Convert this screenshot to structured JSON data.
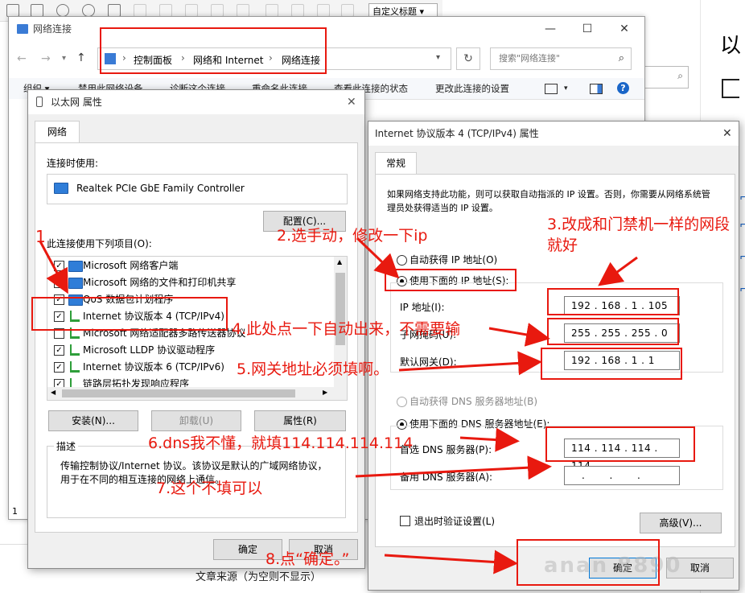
{
  "explorer": {
    "title": "网络连接",
    "breadcrumb": [
      "控制面板",
      "网络和 Internet",
      "网络连接"
    ],
    "search_placeholder": "搜索\"网络连接\"",
    "commands": [
      "组织 ▾",
      "禁用此网络设备",
      "诊断这个连接",
      "重命名此连接",
      "查看此连接的状态",
      "更改此连接的设置"
    ],
    "status_left": "1"
  },
  "eth_dialog": {
    "title": "以太网 属性",
    "tab": "网络",
    "connect_using_label": "连接时使用:",
    "adapter_name": "Realtek PCIe GbE Family Controller",
    "configure_button": "配置(C)...",
    "items_label": "此连接使用下列项目(O):",
    "items": [
      {
        "label": "Microsoft 网络客户端",
        "checked": true
      },
      {
        "label": "Microsoft 网络的文件和打印机共享",
        "checked": true
      },
      {
        "label": "QoS 数据包计划程序",
        "checked": true
      },
      {
        "label": "Internet 协议版本 4 (TCP/IPv4)",
        "checked": true
      },
      {
        "label": "Microsoft 网络适配器多路传送器协议",
        "checked": false
      },
      {
        "label": "Microsoft LLDP 协议驱动程序",
        "checked": true
      },
      {
        "label": "Internet 协议版本 6 (TCP/IPv6)",
        "checked": true
      },
      {
        "label": "链路层拓扑发现响应程序",
        "checked": true
      }
    ],
    "install_button": "安装(N)...",
    "uninstall_button": "卸载(U)",
    "properties_button": "属性(R)",
    "description_title": "描述",
    "description_text": "传输控制协议/Internet 协议。该协议是默认的广域网络协议，用于在不同的相互连接的网络上通信。",
    "ok_button": "确定",
    "cancel_button": "取消"
  },
  "ipv4_dialog": {
    "title": "Internet 协议版本 4 (TCP/IPv4) 属性",
    "tab": "常规",
    "intro": "如果网络支持此功能，则可以获取自动指派的 IP 设置。否则，你需要从网络系统管理员处获得适当的 IP 设置。",
    "auto_ip_label": "自动获得 IP 地址(O)",
    "manual_ip_label": "使用下面的 IP 地址(S):",
    "ip_label": "IP 地址(I):",
    "ip_value": "192 . 168 .  1  . 105",
    "mask_label": "子网掩码(U):",
    "mask_value": "255 . 255 . 255 .  0",
    "gateway_label": "默认网关(D):",
    "gateway_value": "192 . 168 .  1  .  1",
    "auto_dns_label": "自动获得 DNS 服务器地址(B)",
    "manual_dns_label": "使用下面的 DNS 服务器地址(E):",
    "pref_dns_label": "首选 DNS 服务器(P):",
    "pref_dns_value": "114 . 114 . 114 . 114",
    "alt_dns_label": "备用 DNS 服务器(A):",
    "alt_dns_value": "   .       .       .",
    "validate_label": "退出时验证设置(L)",
    "advanced_button": "高级(V)...",
    "ok_button": "确定",
    "cancel_button": "取消"
  },
  "annotations": {
    "a1": "1",
    "a2": "2.选手动，修改一下ip",
    "a3": "3.改成和门禁机一样的网段就好",
    "a4": "4.此处点一下自动出来，不需要输",
    "a5": "5.网关地址必须填啊。",
    "a6": "6.dns我不懂，就填114.114.114.114",
    "a7": "7.这个不填可以",
    "a8": "8.点“确定。”",
    "color": "#e8190f"
  },
  "background": {
    "style_box": "自定义标题",
    "right_big1": "以",
    "article_source": "文章来源（为空则不显示）",
    "watermark": "anan  8890"
  }
}
